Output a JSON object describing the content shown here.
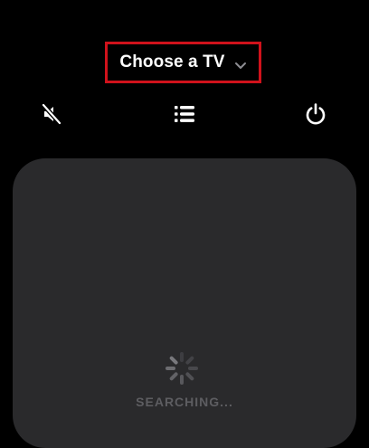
{
  "header": {
    "tv_selector_label": "Choose a TV",
    "tv_selector_icon": "chevron-down-icon",
    "highlight_color": "#d0121b"
  },
  "toolbar": {
    "mute_icon": "mute-icon",
    "list_icon": "list-icon",
    "power_icon": "power-icon"
  },
  "remote": {
    "status_label": "SEARCHING...",
    "status_icon": "loading-spinner-icon",
    "panel_color": "#2a2a2c"
  }
}
